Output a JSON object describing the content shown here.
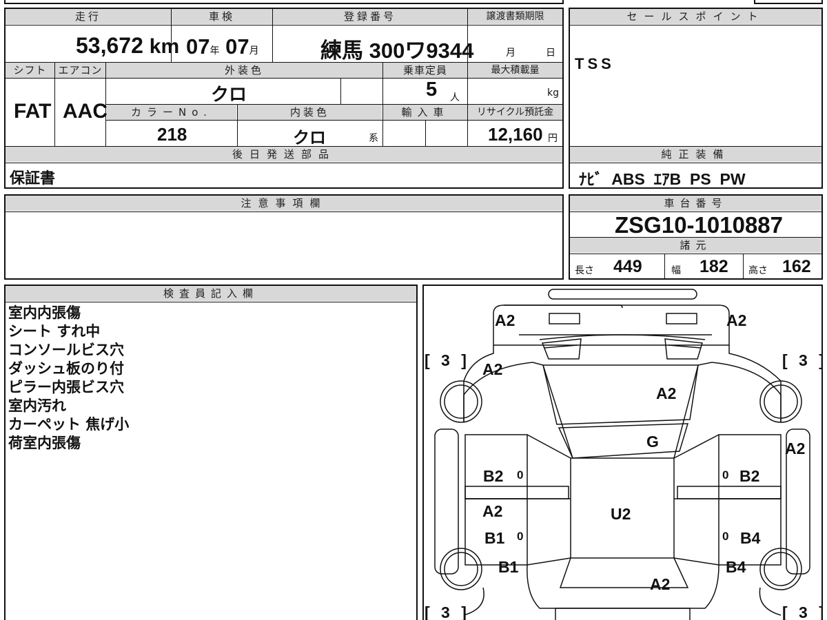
{
  "top_info": {
    "h_mileage": "走行",
    "h_shaken": "車検",
    "h_reg": "登録番号",
    "h_transfer": "譲渡書類期限",
    "mileage": "53,672",
    "mileage_unit": "km",
    "shaken_year": "07",
    "shaken_year_unit": "年",
    "shaken_month": "07",
    "shaken_month_unit": "月",
    "reg_region": "練馬",
    "reg_number": "300ワ9344",
    "transfer_month_unit": "月",
    "transfer_day_unit": "日",
    "h_shift": "シフト",
    "h_ac": "エアコン",
    "h_exterior": "外装色",
    "h_capacity": "乗車定員",
    "h_maxload": "最大積載量",
    "shift": "FAT",
    "ac": "AAC",
    "exterior_color": "クロ",
    "capacity": "5",
    "capacity_unit": "人",
    "maxload_unit": "kg",
    "h_color_no": "カラーNo.",
    "h_interior": "内装色",
    "h_import": "輸入車",
    "h_recycle": "リサイクル預託金",
    "color_no": "218",
    "interior_color": "クロ",
    "interior_suffix": "系",
    "recycle": "12,160",
    "recycle_unit": "円",
    "h_later_parts": "後日発送部品",
    "later_parts": "保証書"
  },
  "sales_point": {
    "header": "セールスポイント",
    "text": "TSS"
  },
  "equipment": {
    "header": "純正装備",
    "text": "ﾅﾋﾞ  ABS  ｴｱB  PS  PW"
  },
  "notes": {
    "header": "注意事項欄"
  },
  "chassis": {
    "header": "車台番号",
    "number": "ZSG10-1010887",
    "spec_header": "諸元",
    "length_label": "長さ",
    "length": "449",
    "width_label": "幅",
    "width": "182",
    "height_label": "高さ",
    "height": "162"
  },
  "inspector": {
    "header": "検査員記入欄",
    "items": [
      "室内内張傷",
      "シート すれ中",
      "コンソールビス穴",
      "ダッシュ板のり付",
      "ピラー内張ビス穴",
      "室内汚れ",
      "カーペット 焦げ小",
      "荷室内張傷"
    ]
  },
  "diagram": {
    "tire_fl": "[ 3 ]",
    "tire_fr": "[ 3 ]",
    "tire_rl": "[ 3 ]",
    "tire_rr": "[ 3 ]",
    "front_bumper_left": "A2",
    "front_bumper_right": "A2",
    "front_fender_left": "A2",
    "hood": "A2",
    "windshield": "G",
    "right_fender": "A2",
    "front_door_left": "B2",
    "front_door_right": "B2",
    "roof": "U2",
    "rear_door_left_a": "A2",
    "rear_door_left_b": "B1",
    "rear_door_right": "B4",
    "rear_quarter_left": "B1",
    "rear_quarter_right": "B4",
    "rear_center": "A2",
    "zero_1": "0",
    "zero_2": "0",
    "zero_3": "0",
    "zero_4": "0"
  }
}
